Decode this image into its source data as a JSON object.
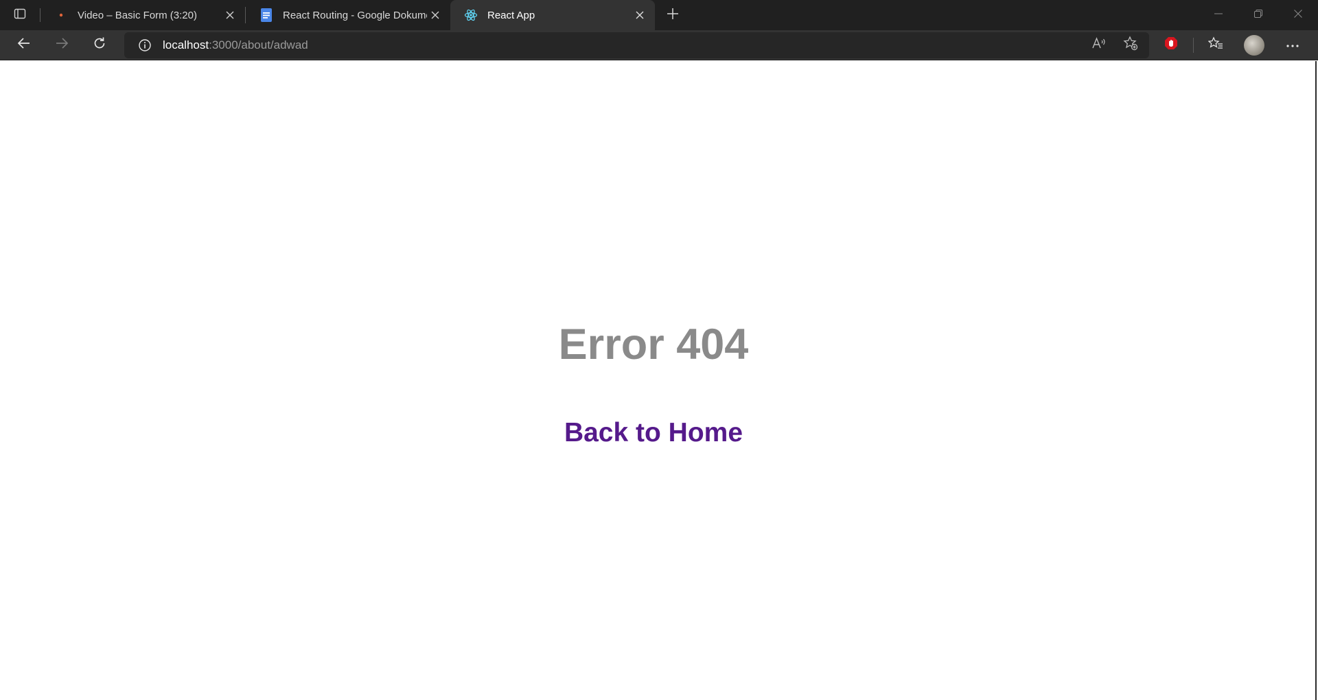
{
  "browser": {
    "tabs": [
      {
        "title": "Video – Basic Form (3:20)",
        "icon": "dot-icon",
        "active": false
      },
      {
        "title": "React Routing - Google Dokume",
        "icon": "google-docs-icon",
        "active": false
      },
      {
        "title": "React App",
        "icon": "react-icon",
        "active": true
      }
    ],
    "address": {
      "host": "localhost",
      "path": ":3000/about/adwad"
    }
  },
  "page": {
    "error_title": "Error 404",
    "home_link": "Back to Home"
  },
  "colors": {
    "error_title": "#8a8a8a",
    "link": "#551a8b",
    "tab_strip": "#202020",
    "toolbar": "#333333"
  }
}
